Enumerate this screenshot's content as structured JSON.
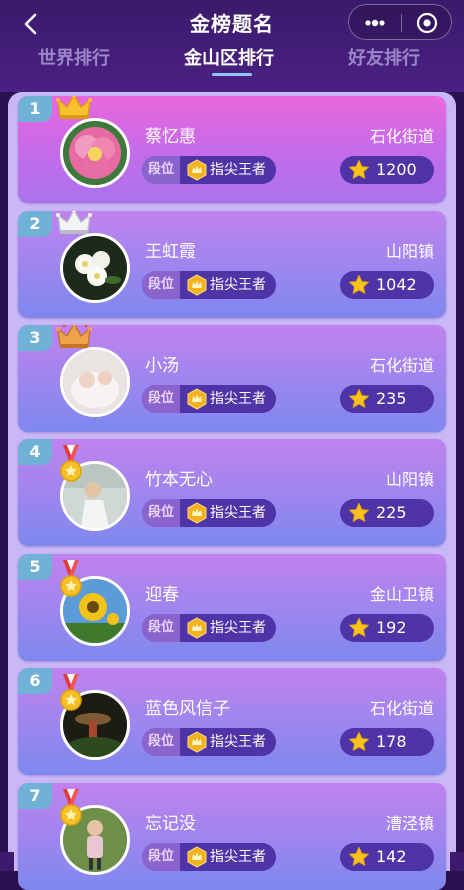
{
  "header": {
    "title": "金榜题名",
    "tabs": [
      {
        "label": "世界排行",
        "active": false
      },
      {
        "label": "金山区排行",
        "active": true
      },
      {
        "label": "好友排行",
        "active": false
      }
    ],
    "icons": {
      "back": "chevron-left-icon",
      "more": "more-dots-icon",
      "close": "target-close-icon"
    }
  },
  "colors": {
    "header_bg": "#4b2184",
    "list_bg": "#c9b7f6",
    "rank_badge": "#6fb2d6",
    "pill_bg": "#4e34a6",
    "tab_underline": "#8ec3ef"
  },
  "ranking": {
    "rank_label": "段位",
    "entries": [
      {
        "rank": "1",
        "name": "蔡忆惠",
        "location": "石化街道",
        "tier": "指尖王者",
        "score": "1200",
        "decoration": "gold-crown",
        "avatar": "pink-flower"
      },
      {
        "rank": "2",
        "name": "王虹霞",
        "location": "山阳镇",
        "tier": "指尖王者",
        "score": "1042",
        "decoration": "silver-crown",
        "avatar": "white-flowers"
      },
      {
        "rank": "3",
        "name": "小汤",
        "location": "石化街道",
        "tier": "指尖王者",
        "score": "235",
        "decoration": "bronze-crown",
        "avatar": "baby-photo"
      },
      {
        "rank": "4",
        "name": "竹本无心",
        "location": "山阳镇",
        "tier": "指尖王者",
        "score": "225",
        "decoration": "medal",
        "avatar": "person-photo"
      },
      {
        "rank": "5",
        "name": "迎春",
        "location": "金山卫镇",
        "tier": "指尖王者",
        "score": "192",
        "decoration": "medal",
        "avatar": "sunflower"
      },
      {
        "rank": "6",
        "name": "蓝色风信子",
        "location": "石化街道",
        "tier": "指尖王者",
        "score": "178",
        "decoration": "medal",
        "avatar": "dark-garden"
      },
      {
        "rank": "7",
        "name": "忘记没",
        "location": "漕泾镇",
        "tier": "指尖王者",
        "score": "142",
        "decoration": "medal",
        "avatar": "child-photo"
      }
    ]
  }
}
